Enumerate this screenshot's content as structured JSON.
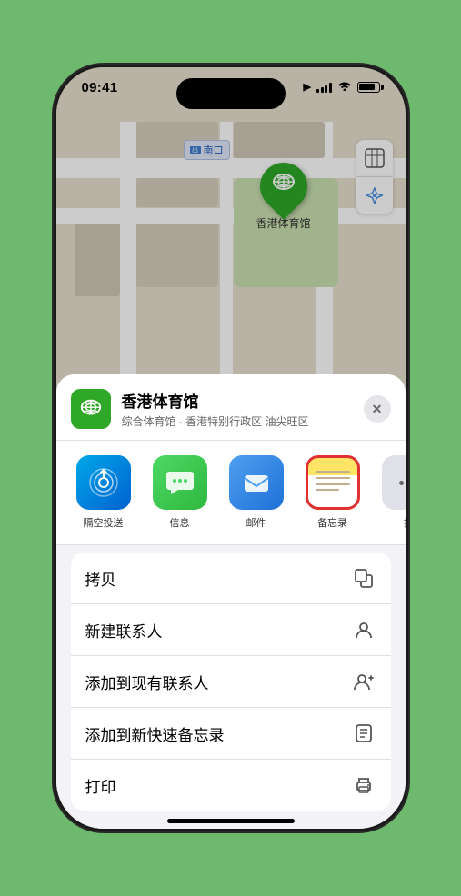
{
  "statusBar": {
    "time": "09:41",
    "locationArrow": "▲"
  },
  "map": {
    "label": "南口",
    "labelPrefix": "出",
    "controls": {
      "mapIcon": "🗺",
      "locationIcon": "⬆"
    }
  },
  "pin": {
    "label": "香港体育馆"
  },
  "sheet": {
    "venueName": "香港体育馆",
    "venueDesc": "综合体育馆 · 香港特别行政区 油尖旺区",
    "closeLabel": "✕",
    "apps": [
      {
        "id": "airdrop",
        "label": "隔空投送"
      },
      {
        "id": "messages",
        "label": "信息"
      },
      {
        "id": "mail",
        "label": "邮件"
      },
      {
        "id": "notes",
        "label": "备忘录"
      },
      {
        "id": "more",
        "label": "提"
      }
    ],
    "actions": [
      {
        "label": "拷贝",
        "icon": "copy"
      },
      {
        "label": "新建联系人",
        "icon": "person"
      },
      {
        "label": "添加到现有联系人",
        "icon": "person-add"
      },
      {
        "label": "添加到新快速备忘录",
        "icon": "memo"
      },
      {
        "label": "打印",
        "icon": "print"
      }
    ]
  }
}
